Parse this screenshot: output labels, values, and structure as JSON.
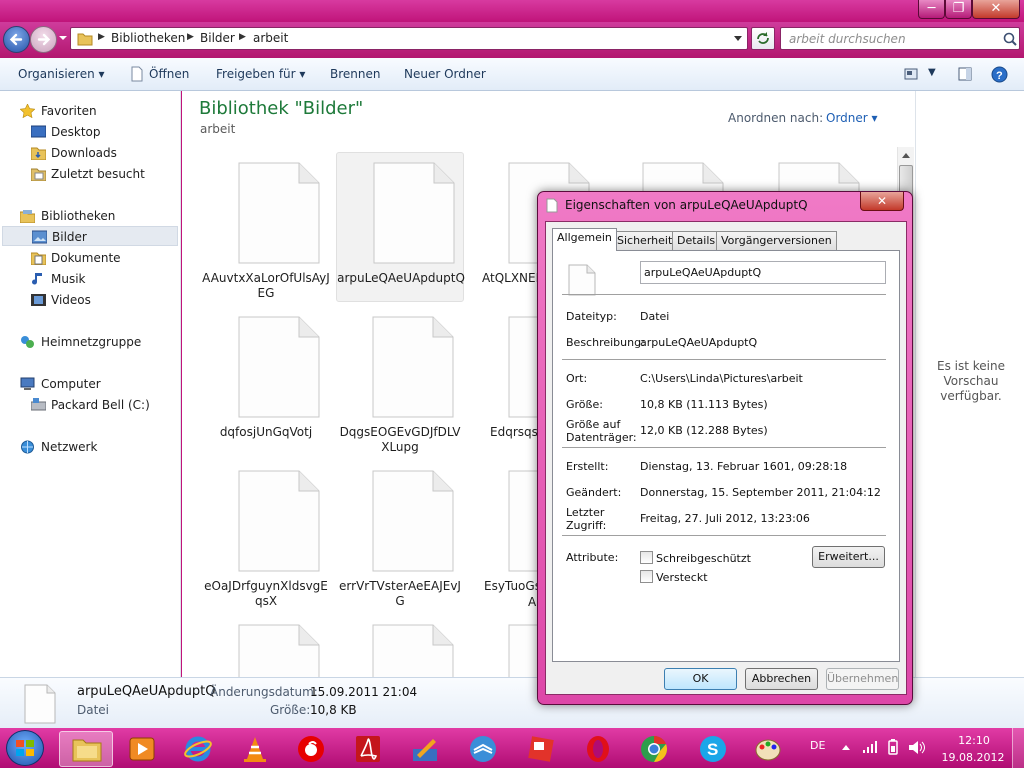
{
  "window": {
    "minimize_label": "─",
    "maximize_label": "❐",
    "close_label": "✕"
  },
  "address": {
    "segments": [
      "Bibliotheken",
      "Bilder",
      "arbeit"
    ],
    "search_placeholder": "arbeit durchsuchen"
  },
  "toolbar": {
    "organize": "Organisieren",
    "open": "Öffnen",
    "share": "Freigeben für",
    "burn": "Brennen",
    "new_folder": "Neuer Ordner"
  },
  "sidebar": {
    "favorites": "Favoriten",
    "desktop": "Desktop",
    "downloads": "Downloads",
    "recent": "Zuletzt besucht",
    "libraries": "Bibliotheken",
    "pictures": "Bilder",
    "documents": "Dokumente",
    "music": "Musik",
    "videos": "Videos",
    "homegroup": "Heimnetzgruppe",
    "computer": "Computer",
    "drive": "Packard Bell (C:)",
    "network": "Netzwerk"
  },
  "content": {
    "title": "Bibliothek \"Bilder\"",
    "subtitle": "arbeit",
    "arrange_label": "Anordnen nach:",
    "arrange_value": "Ordner",
    "files": [
      "AAuvtxXaLorOfUlsAyJEG",
      "arpuLeQAeUApduptQ",
      "AtQLXNEI",
      "dqfosjUnGqVotj",
      "DqgsEOGEvGDJfDLVXLupg",
      "Edqrsqse",
      "eOaJDrfguynXldsvgEqsX",
      "errVrTVsterAeEAJEvJG",
      "EsyTuoGs"
    ],
    "partial_under_dialog": "A"
  },
  "preview": {
    "message": "Es ist keine Vorschau verfügbar."
  },
  "details": {
    "name": "arpuLeQAeUApduptQ",
    "type": "Datei",
    "modified_label": "Änderungsdatum:",
    "modified_value": "15.09.2011 21:04",
    "size_label": "Größe:",
    "size_value": "10,8 KB"
  },
  "dialog": {
    "title": "Eigenschaften von arpuLeQAeUApduptQ",
    "close_label": "✕",
    "tabs": [
      "Allgemein",
      "Sicherheit",
      "Details",
      "Vorgängerversionen"
    ],
    "filename": "arpuLeQAeUApduptQ",
    "rows": {
      "type_label": "Dateityp:",
      "type_value": "Datei",
      "desc_label": "Beschreibung:",
      "desc_value": "arpuLeQAeUApduptQ",
      "location_label": "Ort:",
      "location_value": "C:\\Users\\Linda\\Pictures\\arbeit",
      "size_label": "Größe:",
      "size_value": "10,8 KB (11.113 Bytes)",
      "disk_label_1": "Größe auf",
      "disk_label_2": "Datenträger:",
      "disk_value": "12,0 KB (12.288 Bytes)",
      "created_label": "Erstellt:",
      "created_value": "Dienstag, 13. Februar 1601, 09:28:18",
      "modified_label": "Geändert:",
      "modified_value": "Donnerstag, 15. September 2011, 21:04:12",
      "accessed_label_1": "Letzter",
      "accessed_label_2": "Zugriff:",
      "accessed_value": "Freitag, 27. Juli 2012, 13:23:06",
      "attr_label": "Attribute:",
      "readonly_label": "Schreibgeschützt",
      "hidden_label": "Versteckt",
      "advanced_button": "Erweitert..."
    },
    "buttons": {
      "ok": "OK",
      "cancel": "Abbrechen",
      "apply": "Übernehmen"
    }
  },
  "taskbar": {
    "language": "DE",
    "time": "12:10",
    "date": "19.08.2012"
  }
}
